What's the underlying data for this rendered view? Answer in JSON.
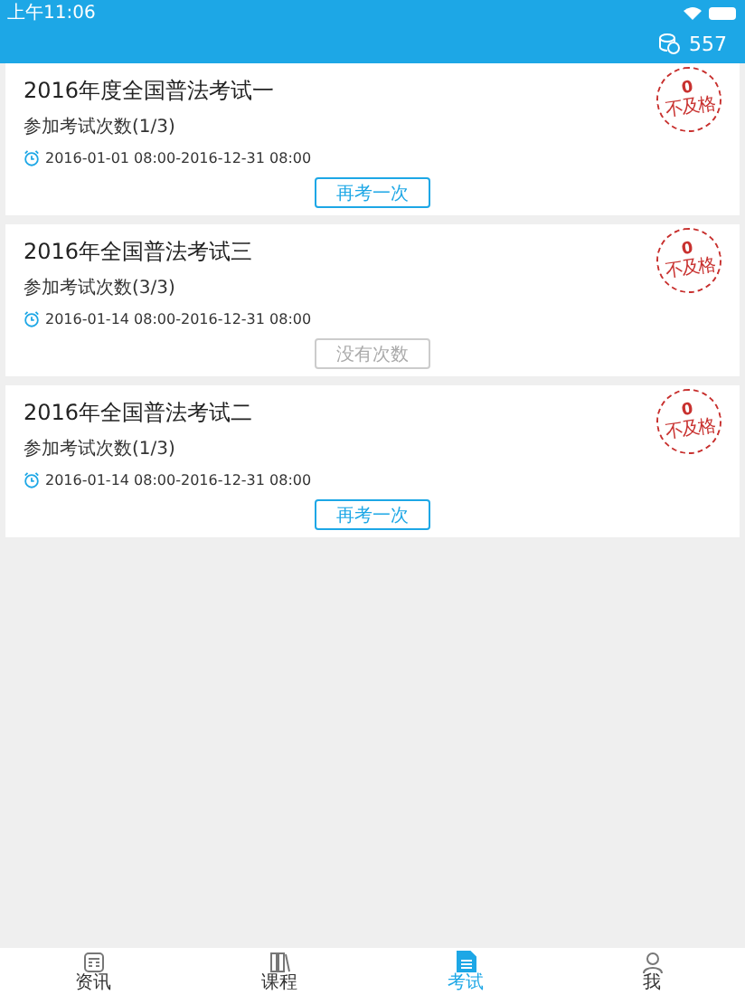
{
  "status_bar": {
    "time": "上午11:06"
  },
  "header": {
    "points": "557"
  },
  "exams": [
    {
      "title": "2016年度全国普法考试一",
      "attempts": "参加考试次数(1/3)",
      "period": "2016-01-01 08:00-2016-12-31 08:00",
      "score": "0",
      "result": "不及格",
      "action": "再考一次",
      "disabled": false
    },
    {
      "title": "2016年全国普法考试三",
      "attempts": "参加考试次数(3/3)",
      "period": "2016-01-14 08:00-2016-12-31 08:00",
      "score": "0",
      "result": "不及格",
      "action": "没有次数",
      "disabled": true
    },
    {
      "title": "2016年全国普法考试二",
      "attempts": "参加考试次数(1/3)",
      "period": "2016-01-14 08:00-2016-12-31 08:00",
      "score": "0",
      "result": "不及格",
      "action": "再考一次",
      "disabled": false
    }
  ],
  "tabs": [
    {
      "label": "资讯",
      "kind": "news",
      "selected": false
    },
    {
      "label": "课程",
      "kind": "books",
      "selected": false
    },
    {
      "label": "考试",
      "kind": "exam",
      "selected": true
    },
    {
      "label": "我",
      "kind": "me",
      "selected": false
    }
  ]
}
